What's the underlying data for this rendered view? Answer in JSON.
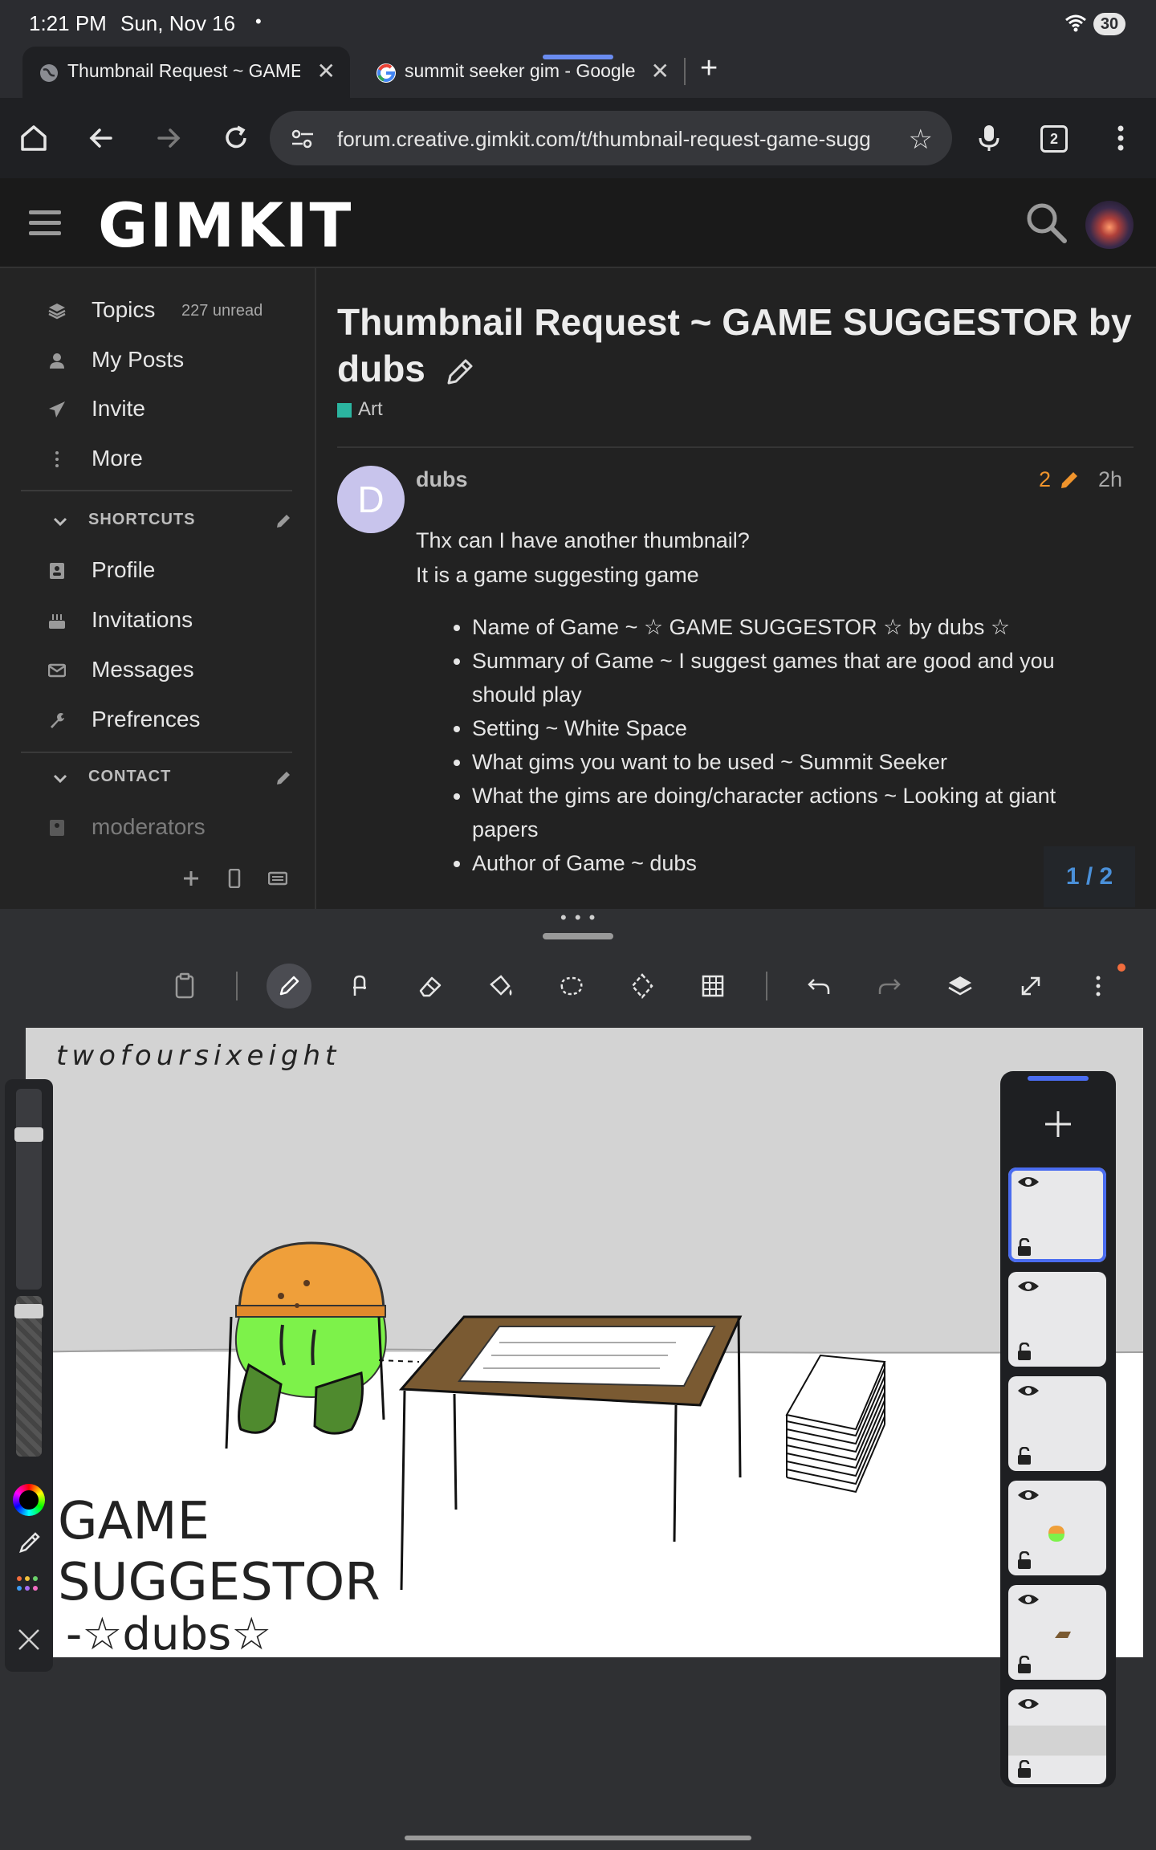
{
  "status_bar": {
    "time": "1:21 PM",
    "date": "Sun, Nov 16",
    "dot": "•",
    "battery": "30"
  },
  "tabs": [
    {
      "title": "Thumbnail Request ~ GAME SU",
      "icon": "globe-icon",
      "active": true
    },
    {
      "title": "summit seeker gim - Google S",
      "icon": "google-icon",
      "active": false
    }
  ],
  "toolbar": {
    "url": "forum.creative.gimkit.com/t/thumbnail-request-game-sugg",
    "tab_count": "2"
  },
  "forum": {
    "logo": "GIMKIT",
    "sidebar": {
      "items": [
        {
          "label": "Topics",
          "count": "227 unread",
          "icon": "layers-icon"
        },
        {
          "label": "My Posts",
          "icon": "user-icon"
        },
        {
          "label": "Invite",
          "icon": "paper-plane-icon"
        },
        {
          "label": "More",
          "icon": "vertical-ellipsis-icon"
        }
      ],
      "shortcuts_title": "SHORTCUTS",
      "shortcuts": [
        {
          "label": "Profile",
          "icon": "address-card-icon"
        },
        {
          "label": "Invitations",
          "icon": "cake-icon"
        },
        {
          "label": "Messages",
          "icon": "envelope-icon"
        },
        {
          "label": "Prefrences",
          "icon": "wrench-icon"
        }
      ],
      "contact_title": "CONTACT",
      "contact": [
        {
          "label": "moderators",
          "icon": "address-card-icon"
        }
      ]
    },
    "topic": {
      "title": "Thumbnail Request ~ GAME SUGGESTOR by dubs",
      "category": "Art",
      "category_color": "#2bb5a0"
    },
    "post": {
      "avatar_letter": "D",
      "username": "dubs",
      "edit_count": "2",
      "age": "2h",
      "lines": [
        "Thx can I have another thumbnail?",
        "It is a game suggesting game"
      ],
      "bullets": [
        "Name of Game ~ ☆ GAME SUGGESTOR ☆ by dubs ☆",
        "Summary of Game ~ I suggest games that are good and you should play",
        "Setting ~ White Space",
        "What gims you want to be used ~ Summit Seeker",
        "What the gims are doing/character actions ~ Looking at giant papers",
        "Author of Game ~ dubs"
      ]
    },
    "pager": "1 / 2"
  },
  "drawing": {
    "canvas_text_top": "twofoursixeight",
    "canvas_text_title": [
      "GAME",
      "SUGGESTOR",
      "-☆dubs☆"
    ],
    "layers_count": 6
  },
  "colors": {
    "accent": "#4a6cf0",
    "orange": "#f0942c",
    "link_blue": "#4a90d9"
  }
}
